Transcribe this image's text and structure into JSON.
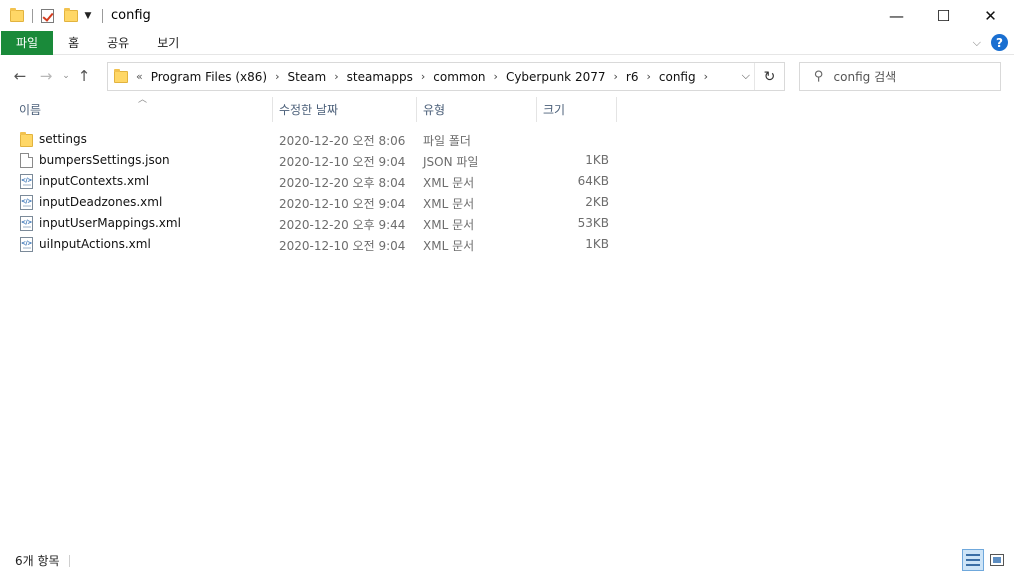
{
  "window": {
    "title": "config",
    "controls": {
      "minimize": "—",
      "maximize": "☐",
      "close": "✕"
    }
  },
  "ribbon": {
    "tabs": [
      "파일",
      "홈",
      "공유",
      "보기"
    ],
    "collapse_icon": "chevron-down-icon",
    "help_label": "?"
  },
  "nav": {
    "back": "←",
    "forward": "→",
    "recent": "⌄",
    "up": "↑",
    "overflow": "«",
    "breadcrumb": [
      "Program Files (x86)",
      "Steam",
      "steamapps",
      "common",
      "Cyberpunk 2077",
      "r6",
      "config"
    ],
    "refresh": "↻",
    "search_placeholder": "config 검색"
  },
  "columns": [
    "이름",
    "수정한 날짜",
    "유형",
    "크기"
  ],
  "files": [
    {
      "name": "settings",
      "date": "2020-12-20 오전 8:06",
      "type": "파일 폴더",
      "size": "",
      "icon": "folder-icon"
    },
    {
      "name": "bumpersSettings.json",
      "date": "2020-12-10 오전 9:04",
      "type": "JSON 파일",
      "size": "1KB",
      "icon": "file-icon"
    },
    {
      "name": "inputContexts.xml",
      "date": "2020-12-20 오후 8:04",
      "type": "XML 문서",
      "size": "64KB",
      "icon": "xml-file-icon"
    },
    {
      "name": "inputDeadzones.xml",
      "date": "2020-12-10 오전 9:04",
      "type": "XML 문서",
      "size": "2KB",
      "icon": "xml-file-icon"
    },
    {
      "name": "inputUserMappings.xml",
      "date": "2020-12-20 오후 9:44",
      "type": "XML 문서",
      "size": "53KB",
      "icon": "xml-file-icon"
    },
    {
      "name": "uiInputActions.xml",
      "date": "2020-12-10 오전 9:04",
      "type": "XML 문서",
      "size": "1KB",
      "icon": "xml-file-icon"
    }
  ],
  "status": {
    "item_count": "6개 항목"
  },
  "colors": {
    "file_tab": "#1a8a3a",
    "help": "#1a6fd1",
    "folder": "#ffd766",
    "header_text": "#4c607a"
  }
}
